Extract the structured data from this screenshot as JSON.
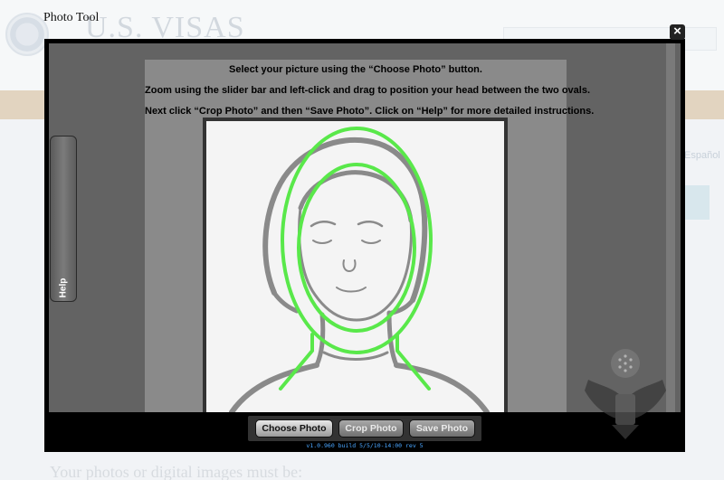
{
  "dialog": {
    "title": "Photo Tool",
    "close_label": "×"
  },
  "background": {
    "site_title": "U.S. VISAS",
    "language_link": "Español",
    "bottom_text": "Your photos or digital images must be:"
  },
  "instructions": [
    "Select your picture using the “Choose Photo” button.",
    "Zoom using the slider bar and left-click and drag to position your head between the two ovals.",
    "Next click “Crop Photo” and then “Save Photo”.  Click on “Help” for more detailed instructions."
  ],
  "help_tab": {
    "label": "Help"
  },
  "toolbar": {
    "choose_label": "Choose Photo",
    "crop_label": "Crop Photo",
    "save_label": "Save Photo"
  },
  "version": "v1.0.960 build 5/5/10-14:00 rev 5",
  "colors": {
    "guide_oval": "#59e84a",
    "sketch_stroke": "#8a8a8a",
    "version_text": "#4aa6ff"
  }
}
